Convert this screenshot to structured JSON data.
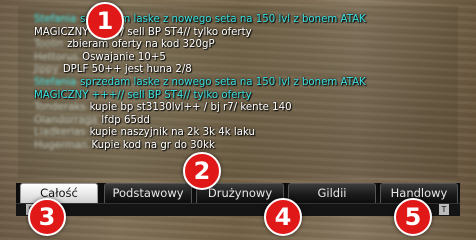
{
  "messages": [
    {
      "sender": "Stefania",
      "text": "sprzedam laske z nowego seta na 150 lvl z bonem ATAK",
      "color": "cyan"
    },
    {
      "sender": "",
      "text": "MAGICZNY +++// sell BP ST4// tylko oferty",
      "color": "white"
    },
    {
      "sender": "Toolin",
      "text": "zbieram oferty na kod 320gP",
      "color": "white"
    },
    {
      "sender": "Hettorus",
      "text": "Oswajanie 10+5",
      "color": "white"
    },
    {
      "sender": "Jippy",
      "text": "DPLF 50++ jest huna 2/8",
      "color": "white"
    },
    {
      "sender": "Stefania",
      "text": "sprzedam laske z nowego seta na 150 lvl z bonem ATAK",
      "color": "cyan"
    },
    {
      "sender": "",
      "text": "MAGICZNY +++// sell BP ST4// tylko oferty",
      "color": "cyan"
    },
    {
      "sender": "Tonderaks",
      "text": "kupie bp st3130lvl++ / bj r7/ kente 140",
      "color": "white"
    },
    {
      "sender": "Olandorraga",
      "text": "lfdp 65dd",
      "color": "white"
    },
    {
      "sender": "Liadkerias",
      "text": "kupie naszyjnik na 2k 3k 4k laku",
      "color": "white"
    },
    {
      "sender": "Hugerman",
      "text": "Kupie kod na gr do 30kk",
      "color": "white"
    }
  ],
  "tabs": [
    "Całość",
    "Podstawowy",
    "Drużynowy",
    "Gildii",
    "Handlowy"
  ],
  "corner_left": "S",
  "corner_right": "T",
  "markers": [
    "1",
    "2",
    "3",
    "4",
    "5"
  ],
  "colors": {
    "cyan": "#3be0e0",
    "marker": "#e01818",
    "tab_active": "#ffffff"
  }
}
